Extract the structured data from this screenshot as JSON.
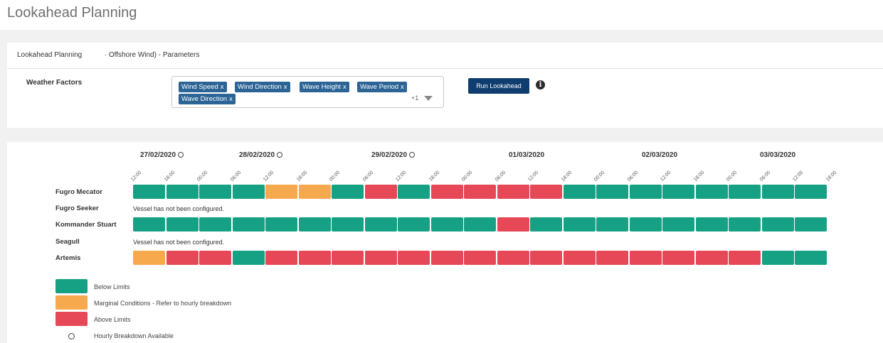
{
  "page": {
    "title": "Lookahead Planning"
  },
  "breadcrumb": {
    "part1": "Lookahead Planning",
    "part2": "· Offshore Wind) - Parameters"
  },
  "weather": {
    "label": "Weather Factors",
    "tags": [
      "Wind Speed",
      "Wind Direction",
      "Wave Height",
      "Wave Period",
      "Wave Direction"
    ],
    "remove_glyph": "x",
    "more": "+1",
    "run_label": "Run Lookahead",
    "info_glyph": "i"
  },
  "colors": {
    "green": "#17a184",
    "orange": "#f7a94e",
    "red": "#e64858",
    "accent": "#0f3d6f"
  },
  "timeline": {
    "dates": [
      {
        "label": "27/02/2020",
        "hourly": true
      },
      {
        "label": "28/02/2020",
        "hourly": true
      },
      {
        "label": "29/02/2020",
        "hourly": true
      },
      {
        "label": "01/03/2020",
        "hourly": false
      },
      {
        "label": "02/03/2020",
        "hourly": false
      },
      {
        "label": "03/03/2020",
        "hourly": false
      }
    ],
    "ticks": [
      "12:00",
      "18:00",
      "00:00",
      "06:00",
      "12:00",
      "18:00",
      "00:00",
      "06:00",
      "12:00",
      "18:00",
      "00:00",
      "06:00",
      "12:00",
      "18:00",
      "00:00",
      "06:00",
      "12:00",
      "18:00",
      "00:00",
      "06:00",
      "12:00",
      "18:00"
    ]
  },
  "vessels": [
    {
      "name": "Fugro Mecator",
      "message": "",
      "cells": [
        "G",
        "G",
        "G",
        "G",
        "O",
        "O",
        "G",
        "R",
        "G",
        "R",
        "R",
        "R",
        "R",
        "G",
        "G",
        "G",
        "G",
        "G",
        "G",
        "G",
        "G"
      ]
    },
    {
      "name": "Fugro Seeker",
      "message": "Vessel has not been configured.",
      "cells": []
    },
    {
      "name": "Kommander Stuart",
      "message": "",
      "cells": [
        "G",
        "G",
        "G",
        "G",
        "G",
        "G",
        "G",
        "G",
        "G",
        "G",
        "G",
        "R",
        "G",
        "G",
        "G",
        "G",
        "G",
        "G",
        "G",
        "G",
        "G"
      ]
    },
    {
      "name": "Seagull",
      "message": "Vessel has not been configured.",
      "cells": []
    },
    {
      "name": "Artemis",
      "message": "",
      "cells": [
        "O",
        "R",
        "R",
        "G",
        "R",
        "R",
        "R",
        "R",
        "R",
        "R",
        "R",
        "R",
        "R",
        "R",
        "R",
        "R",
        "R",
        "R",
        "R",
        "G",
        "G"
      ]
    }
  ],
  "legend": {
    "below": "Below Limits",
    "marginal": "Marginal Conditions - Refer to hourly breakdown",
    "above": "Above Limits",
    "hourly": "Hourly Breakdown Available"
  }
}
